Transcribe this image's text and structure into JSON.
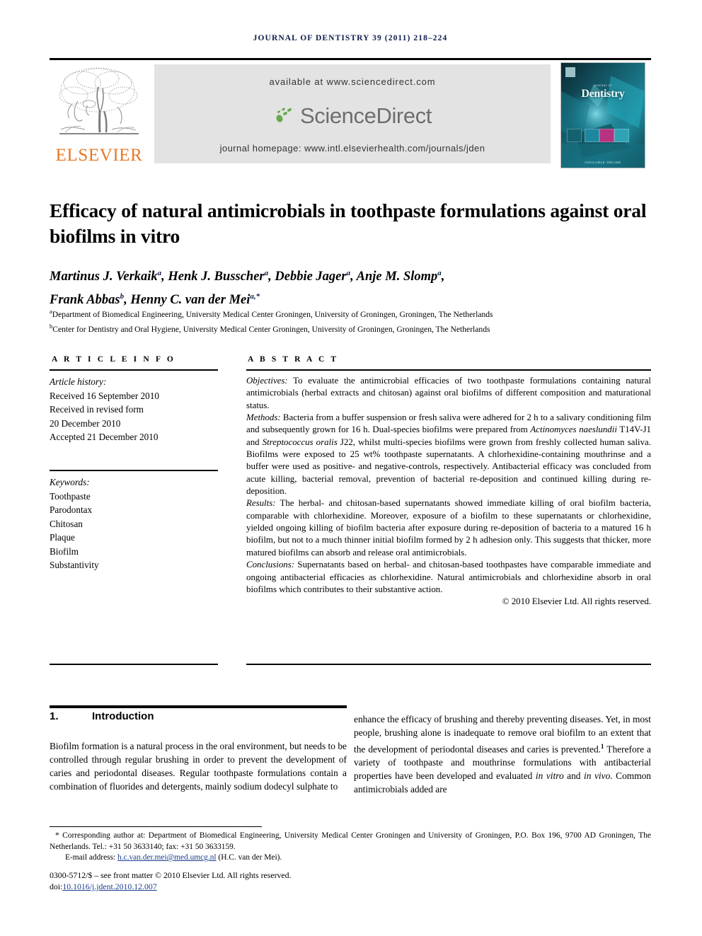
{
  "header": {
    "running_head": "JOURNAL OF DENTISTRY 39 (2011) 218–224",
    "available_at": "available at www.sciencedirect.com",
    "sciencedirect_label": "ScienceDirect",
    "journal_homepage": "journal homepage: www.intl.elsevierhealth.com/journals/jden",
    "publisher_logo_text": "ELSEVIER",
    "cover": {
      "overline": "journal of",
      "title": "Dentistry",
      "footer_text": "AVAILABLE ONLINE"
    },
    "colors": {
      "elsevier_orange": "#E87722",
      "sciencedirect_green": "#66A94B",
      "sciencedirect_gray": "#6d6e70",
      "banner_gray": "#e3e3e3",
      "running_head_navy": "#0d1b4b"
    }
  },
  "article": {
    "title": "Efficacy of natural antimicrobials in toothpaste formulations against oral biofilms in vitro",
    "authors_line1": "Martinus J. Verkaik",
    "authors_html": "Martinus J. Verkaik a, Henk J. Busscher a, Debbie Jager a, Anje M. Slomp a, Frank Abbas b, Henny C. van der Mei a,*",
    "affiliations": [
      "Department of Biomedical Engineering, University Medical Center Groningen, University of Groningen, Groningen, The Netherlands",
      "Center for Dentistry and Oral Hygiene, University Medical Center Groningen, University of Groningen, Groningen, The Netherlands"
    ],
    "affiliation_marks": [
      "a",
      "b"
    ]
  },
  "article_info": {
    "heading": "A R T I C L E   I N F O",
    "history_label": "Article history:",
    "history": [
      "Received 16 September 2010",
      "Received in revised form",
      "20 December 2010",
      "Accepted 21 December 2010"
    ],
    "keywords_label": "Keywords:",
    "keywords": [
      "Toothpaste",
      "Parodontax",
      "Chitosan",
      "Plaque",
      "Biofilm",
      "Substantivity"
    ]
  },
  "abstract": {
    "heading": "A B S T R A C T",
    "objectives_label": "Objectives:",
    "objectives_text": " To evaluate the antimicrobial efficacies of two toothpaste formulations containing natural antimicrobials (herbal extracts and chitosan) against oral biofilms of different composition and maturational status.",
    "methods_label": "Methods:",
    "methods_pre": " Bacteria from a buffer suspension or fresh saliva were adhered for 2 h to a salivary conditioning film and subsequently grown for 16 h. Dual-species biofilms were prepared from ",
    "methods_species1": "Actinomyces naeslundii",
    "methods_mid1": " T14V-J1 and ",
    "methods_species2": "Streptococcus oralis",
    "methods_post": " J22, whilst multi-species biofilms were grown from freshly collected human saliva. Biofilms were exposed to 25 wt% toothpaste supernatants. A chlorhexidine-containing mouthrinse and a buffer were used as positive- and negative-controls, respectively. Antibacterial efficacy was concluded from acute killing, bacterial removal, prevention of bacterial re-deposition and continued killing during re-deposition.",
    "results_label": "Results:",
    "results_text": " The herbal- and chitosan-based supernatants showed immediate killing of oral biofilm bacteria, comparable with chlorhexidine. Moreover, exposure of a biofilm to these supernatants or chlorhexidine, yielded ongoing killing of biofilm bacteria after exposure during re-deposition of bacteria to a matured 16 h biofilm, but not to a much thinner initial biofilm formed by 2 h adhesion only. This suggests that thicker, more matured biofilms can absorb and release oral antimicrobials.",
    "conclusions_label": "Conclusions:",
    "conclusions_text": " Supernatants based on herbal- and chitosan-based toothpastes have comparable immediate and ongoing antibacterial efficacies as chlorhexidine. Natural antimicrobials and chlorhexidine absorb in oral biofilms which contributes to their substantive action.",
    "copyright": "© 2010 Elsevier Ltd. All rights reserved."
  },
  "introduction": {
    "number": "1.",
    "heading": "Introduction",
    "left_text": "Biofilm formation is a natural process in the oral environment, but needs to be controlled through regular brushing in order to prevent the development of caries and periodontal diseases. Regular toothpaste formulations contain a combination of fluorides and detergents, mainly sodium dodecyl sulphate to",
    "right_pre": "enhance the efficacy of brushing and thereby preventing diseases. Yet, in most people, brushing alone is inadequate to remove oral biofilm to an extent that the development of periodontal diseases and caries is prevented.",
    "right_ref": "1",
    "right_mid": " Therefore a variety of toothpaste and mouthrinse formulations with antibacterial properties have been developed and evaluated ",
    "right_ital1": "in vitro",
    "right_and": " and ",
    "right_ital2": "in vivo",
    "right_post": ". Common antimicrobials added are"
  },
  "footer": {
    "corresponding_marker": "*",
    "corresponding_text": " Corresponding author at: Department of Biomedical Engineering, University Medical Center Groningen and University of Groningen, P.O. Box 196, 9700 AD Groningen, The Netherlands. Tel.: +31 50 3633140; fax: +31 50 3633159.",
    "email_label": "E-mail address: ",
    "email": "h.c.van.der.mei@med.umcg.nl",
    "email_suffix": " (H.C. van der Mei).",
    "front_matter": "0300-5712/$ – see front matter © 2010 Elsevier Ltd. All rights reserved.",
    "doi_label": "doi:",
    "doi": "10.1016/j.jdent.2010.12.007"
  }
}
